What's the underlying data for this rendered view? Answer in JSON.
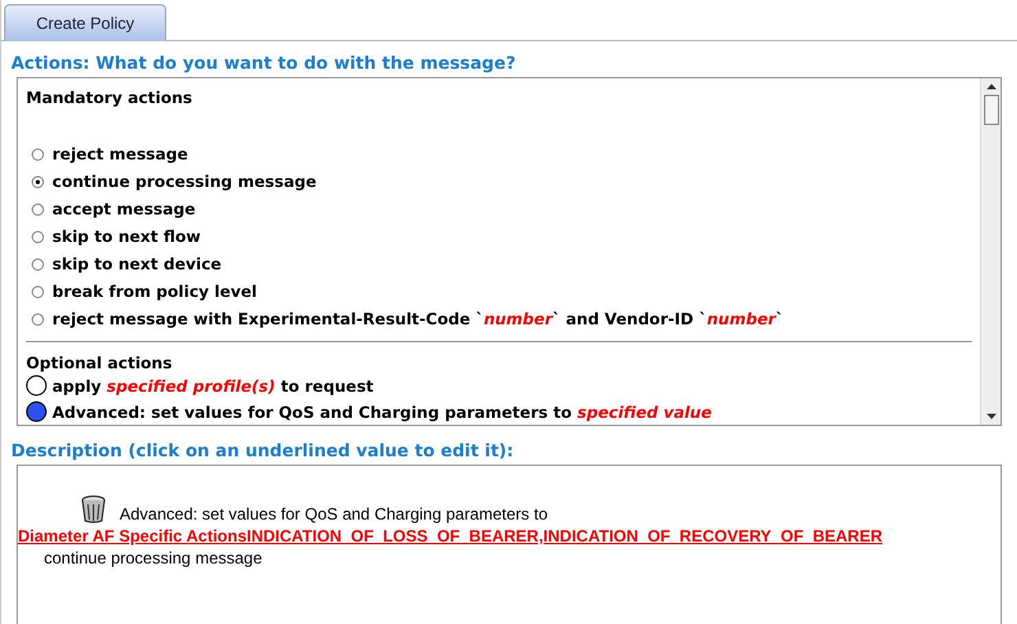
{
  "tabs": [
    {
      "label": "Create Policy",
      "selected": true
    }
  ],
  "actions": {
    "heading": "Actions: What do you want to do with the message?",
    "mandatory": {
      "title": "Mandatory actions",
      "options": [
        {
          "label": "reject message",
          "selected": false
        },
        {
          "label": "continue processing message",
          "selected": true
        },
        {
          "label": "accept message",
          "selected": false
        },
        {
          "label": "skip to next flow",
          "selected": false
        },
        {
          "label": "skip to next device",
          "selected": false
        },
        {
          "label": "break from policy level",
          "selected": false
        },
        {
          "label": "reject message with Experimental-Result-Code `*number*` and Vendor-ID `*number*`",
          "selected": false
        }
      ]
    },
    "optional": {
      "title": "Optional actions",
      "options": [
        {
          "label": "apply *specified profile(s)* to request",
          "selected": false
        },
        {
          "label": "Advanced: set values for QoS and Charging parameters to *specified value*",
          "selected": true
        }
      ]
    }
  },
  "description": {
    "heading": "Description (click on an underlined value to edit it):",
    "action": "Advanced: set values for QoS and Charging parameters to",
    "value_link": "Diameter AF Specific ActionsINDICATION_OF_LOSS_OF_BEARER,INDICATION_OF_RECOVERY_OF_BEARER",
    "next": "continue processing message"
  }
}
